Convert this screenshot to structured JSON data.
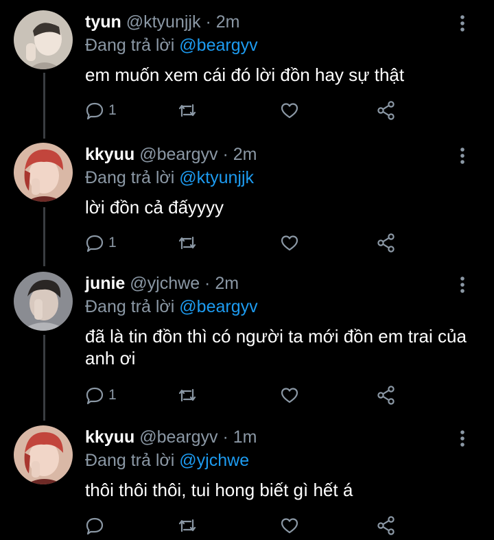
{
  "replying_prefix": "Đang trả lời",
  "tweets": [
    {
      "name": "tyun",
      "handle": "@ktyunjjk",
      "separator": "·",
      "time": "2m",
      "reply_to": "@beargyv",
      "text": "em muốn xem cái đó lời đồn hay sự thật",
      "reply_count": "1",
      "avatar_palette": [
        "#c9c2b8",
        "#efe4da",
        "#3b3530"
      ]
    },
    {
      "name": "kkyuu",
      "handle": "@beargyv",
      "separator": "·",
      "time": "2m",
      "reply_to": "@ktyunjjk",
      "text": "lời đồn cả đấyyyy",
      "reply_count": "1",
      "avatar_palette": [
        "#6e2a26",
        "#f1d6c8",
        "#c2453c"
      ]
    },
    {
      "name": "junie",
      "handle": "@yjchwe",
      "separator": "·",
      "time": "2m",
      "reply_to": "@beargyv",
      "text": "đã là tin đồn thì có người ta mới đồn em trai của anh ơi",
      "reply_count": "1",
      "avatar_palette": [
        "#8a8c92",
        "#d8c9bf",
        "#2a2624"
      ]
    },
    {
      "name": "kkyuu",
      "handle": "@beargyv",
      "separator": "·",
      "time": "1m",
      "reply_to": "@yjchwe",
      "text": "thôi thôi thôi, tui hong biết gì hết á",
      "reply_count": "",
      "avatar_palette": [
        "#6e2a26",
        "#f1d6c8",
        "#c2453c"
      ]
    }
  ],
  "colors": {
    "background": "#000000",
    "text": "#ffffff",
    "secondary": "#8b98a5",
    "link": "#1d9bf0",
    "thread_line": "#3a3d41"
  }
}
